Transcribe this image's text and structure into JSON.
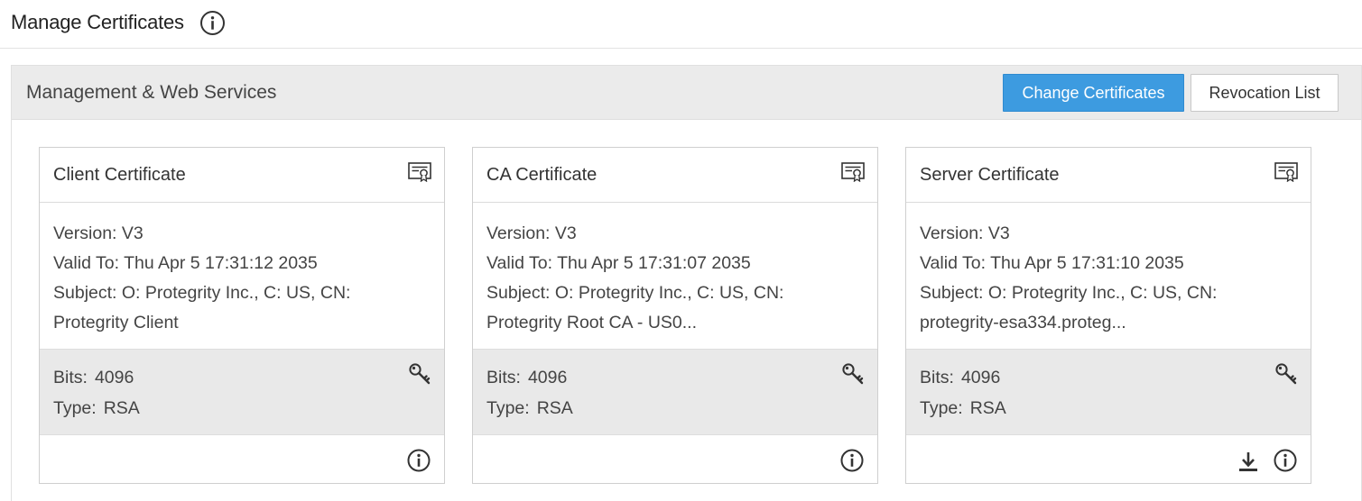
{
  "page": {
    "title": "Manage Certificates"
  },
  "panel": {
    "title": "Management & Web Services",
    "buttons": {
      "change": "Change Certificates",
      "revocation": "Revocation List"
    }
  },
  "labels": {
    "version": "Version:",
    "valid_to": "Valid To:",
    "subject": "Subject:",
    "bits": "Bits:",
    "type": "Type:"
  },
  "cards": [
    {
      "title": "Client Certificate",
      "version": "V3",
      "valid_to": "Thu Apr 5 17:31:12 2035",
      "subject_line1": "O: Protegrity Inc., C: US, CN:",
      "subject_line2": "Protegrity Client",
      "bits": "4096",
      "type": "RSA",
      "icons": [
        "certificate-icon",
        "key-icon",
        "info-icon"
      ]
    },
    {
      "title": "CA Certificate",
      "version": "V3",
      "valid_to": "Thu Apr 5 17:31:07 2035",
      "subject_line1": "O: Protegrity Inc., C: US, CN:",
      "subject_line2": "Protegrity Root CA - US0...",
      "bits": "4096",
      "type": "RSA",
      "icons": [
        "certificate-icon",
        "key-icon",
        "info-icon"
      ]
    },
    {
      "title": "Server Certificate",
      "version": "V3",
      "valid_to": "Thu Apr 5 17:31:10 2035",
      "subject_line1": "O: Protegrity Inc., C: US, CN:",
      "subject_line2": "protegrity-esa334.proteg...",
      "bits": "4096",
      "type": "RSA",
      "icons": [
        "certificate-icon",
        "key-icon",
        "download-icon",
        "info-icon"
      ]
    }
  ],
  "colors": {
    "primary_button": "#3d9be0",
    "panel_header_bg": "#ebebeb",
    "keys_bg": "#e9e9e9",
    "text": "#444444"
  }
}
